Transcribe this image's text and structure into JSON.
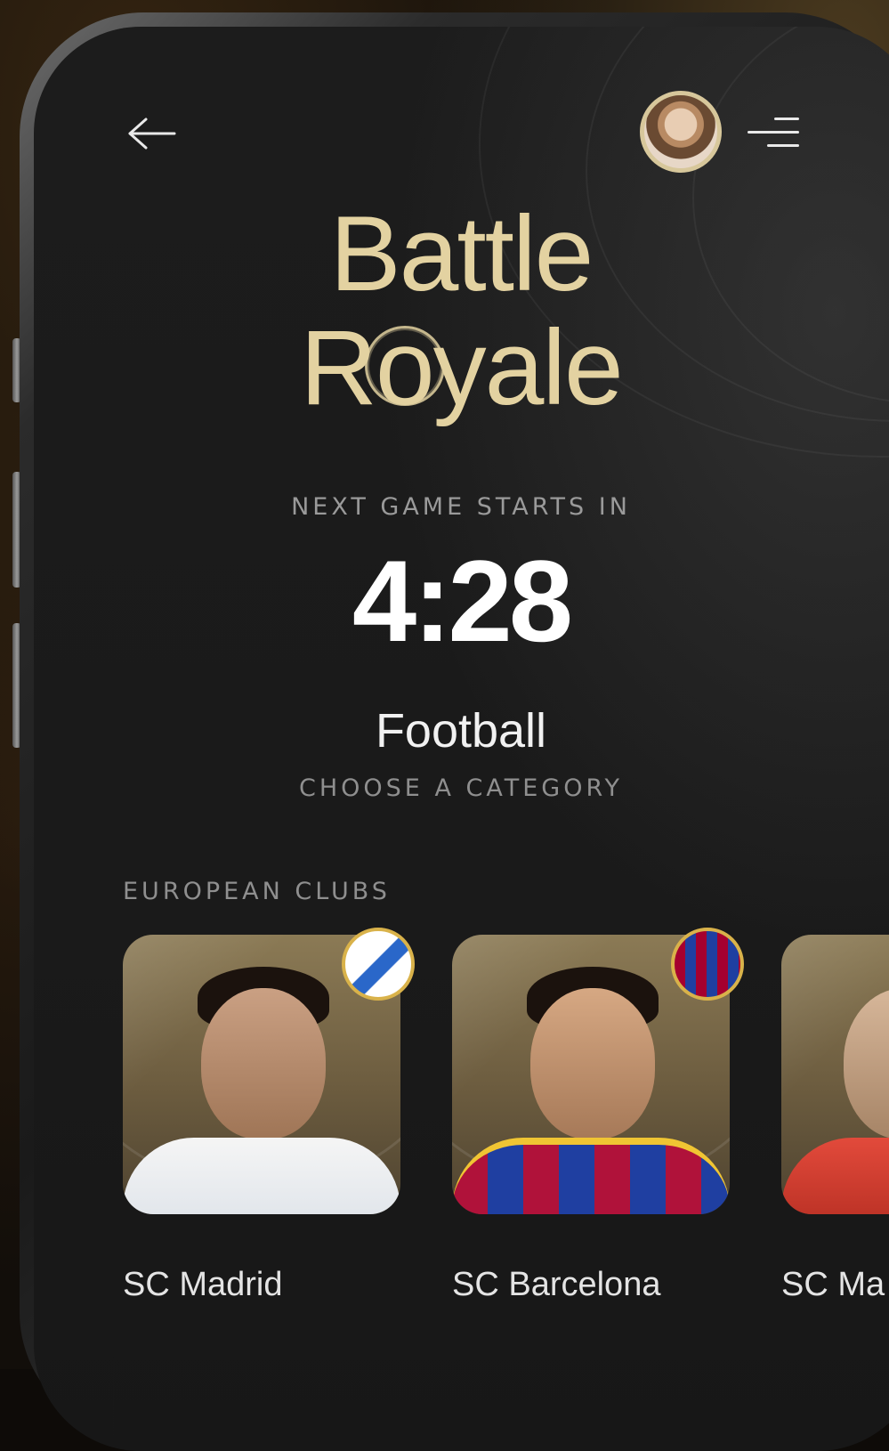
{
  "header": {
    "back_icon": "arrow-left-icon",
    "avatar_icon": "user-avatar",
    "menu_icon": "menu-icon"
  },
  "title": {
    "line1": "Battle",
    "line2": "Royale"
  },
  "countdown": {
    "label": "NEXT GAME STARTS IN",
    "time": "4:28"
  },
  "category": {
    "name": "Football",
    "hint": "CHOOSE A CATEGORY"
  },
  "section": {
    "title": "EUROPEAN CLUBS",
    "clubs": [
      {
        "name": "SC Madrid",
        "crest_colors": [
          "#ffffff",
          "#2a67c9",
          "#e6c34a"
        ]
      },
      {
        "name": "SC Barcelona",
        "crest_colors": [
          "#a5002f",
          "#1f3fa1",
          "#e6c34a"
        ]
      },
      {
        "name": "SC Ma"
      }
    ]
  },
  "colors": {
    "accent_gold": "#e3d2a1",
    "background": "#1a1a1a"
  }
}
